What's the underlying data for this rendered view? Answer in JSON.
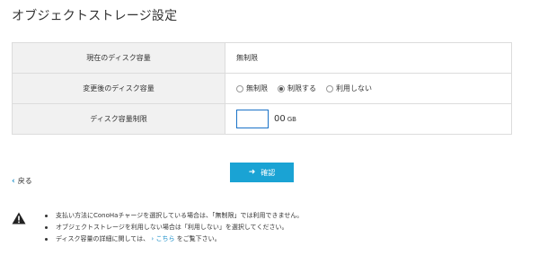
{
  "page": {
    "title": "オブジェクトストレージ設定"
  },
  "table": {
    "rows": [
      {
        "label": "現在のディスク容量",
        "value": "無制限"
      },
      {
        "label": "変更後のディスク容量"
      },
      {
        "label": "ディスク容量制限"
      }
    ],
    "radio_options": [
      {
        "label": "無制限",
        "checked": false
      },
      {
        "label": "制限する",
        "checked": true
      },
      {
        "label": "利用しない",
        "checked": false
      }
    ],
    "disk_limit": {
      "value": "",
      "suffix": "00",
      "unit": "GB"
    }
  },
  "actions": {
    "back_label": "戻る",
    "back_icon": "chevron-left-icon",
    "confirm_label": "確認",
    "confirm_icon": "arrow-right-icon",
    "confirm_color": "#1aa3d4"
  },
  "notice": {
    "icon": "warning-icon",
    "items": [
      {
        "text": "支払い方法にConoHaチャージを選択している場合は、「無制限」では利用できません。"
      },
      {
        "text": "オブジェクトストレージを利用しない場合は「利用しない」を選択してください。"
      },
      {
        "prefix": "ディスク容量の詳細に関しては、",
        "link_arrow": "›",
        "link": "こちら",
        "suffix": "をご覧下さい。"
      }
    ]
  }
}
